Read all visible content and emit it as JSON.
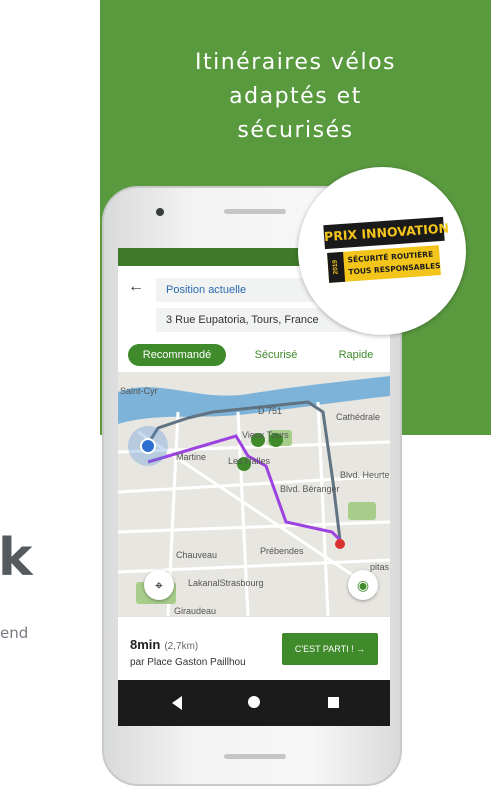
{
  "colors": {
    "brand_green": "#5a9a3f",
    "route_purple": "#9b42e0",
    "badge_yellow": "#f3c41a"
  },
  "promo": {
    "headline_lines": [
      "Itinéraires vélos",
      "adaptés et",
      "sécurisés"
    ],
    "partial_letter": "k",
    "partial_word": "end"
  },
  "badge": {
    "line1": "PRIX INNOVATION",
    "year": "2019",
    "line2": "SÉCURITÉ ROUTIÈRE",
    "line3": "TOUS RESPONSABLES"
  },
  "app": {
    "back_icon": "arrow-left-icon",
    "origin_value": "Position actuelle",
    "destination_value": "3 Rue Eupatoria, Tours, France",
    "tabs": [
      "Recommandé",
      "Sécurisé",
      "Rapide"
    ],
    "active_tab": "Recommandé",
    "map_labels": [
      "Saint-Cyr",
      "D 751",
      "Cathédrale",
      "Vieux Tours",
      "Martine",
      "Les Halles",
      "Blvd. Heurte",
      "Blvd. Béranger",
      "Chauveau",
      "Prébendes",
      "LakanalStrasbourg",
      "Giraudeau",
      "pitas"
    ],
    "locate_icon": "crosshair-icon",
    "visibility_icon": "eye-icon",
    "summary": {
      "time": "8min",
      "distance": "(2,7km)",
      "via": "par Place Gaston Paillhou",
      "go_label": "C'EST PARTI ! →"
    },
    "nav_icons": [
      "back-triangle-icon",
      "home-circle-icon",
      "recent-square-icon"
    ]
  }
}
